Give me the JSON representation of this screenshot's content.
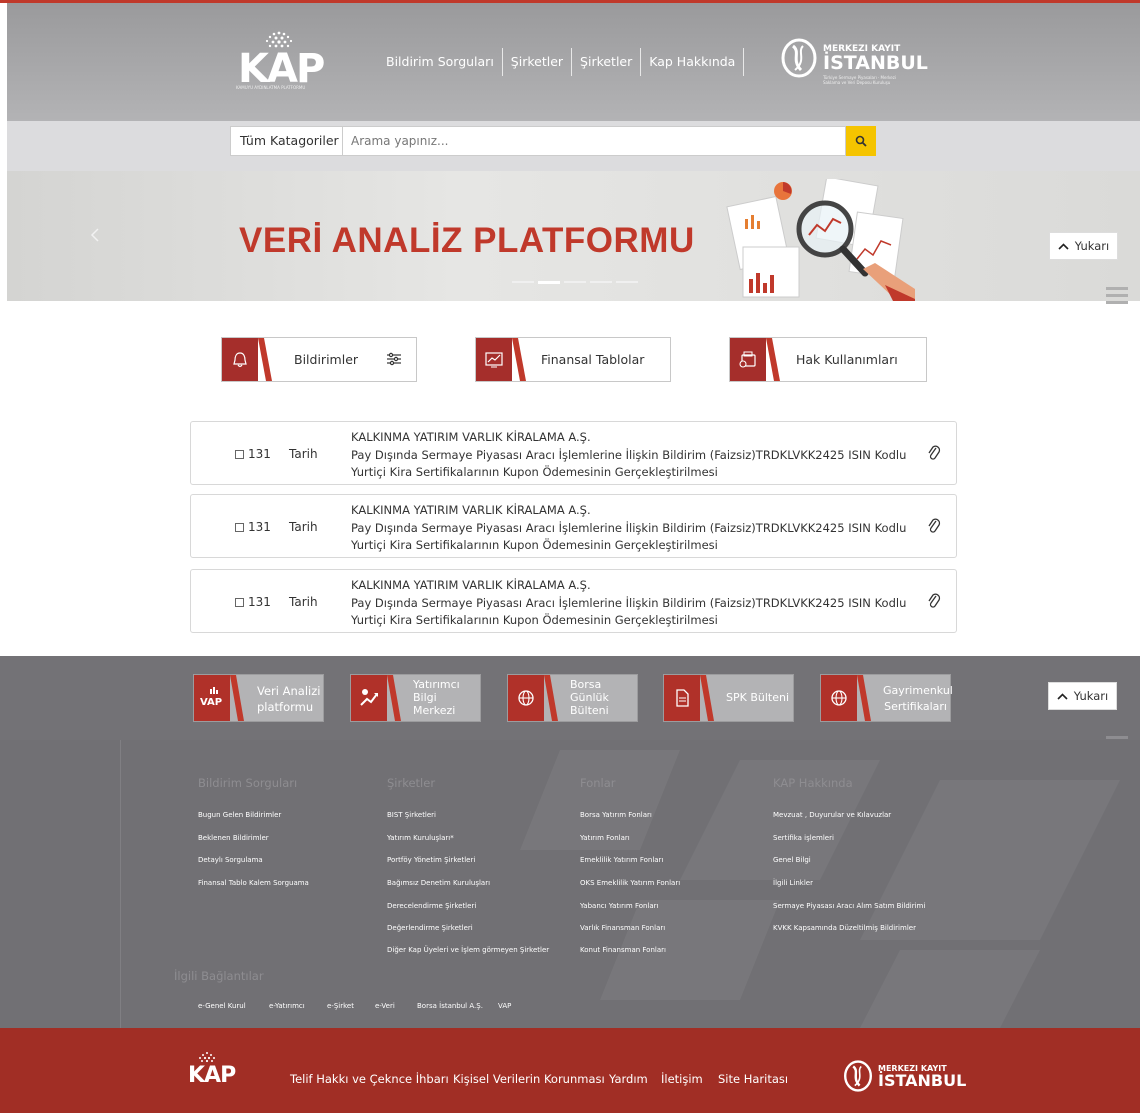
{
  "header": {
    "logo_text": "KAP",
    "logo_tagline": "KAMUYU AYDINLATMA PLATFORMU",
    "nav": [
      "Bildirim Sorguları",
      "Şirketler",
      "Şirketler",
      "Kap Hakkında"
    ],
    "mkk_line1": "MERKEZI KAYIT",
    "mkk_line2": "İSTANBUL",
    "mkk_line3": "Türkiye Sermaye Piyasaları · Merkezi Saklama ve Veri Deposu Kuruluşu"
  },
  "search": {
    "category": "Tüm Katagoriler",
    "placeholder": "Arama yapınız..."
  },
  "banner": {
    "title": "VERİ ANALİZ PLATFORMU",
    "slide_count": 5,
    "active_slide": 2
  },
  "up_button": "Yukarı",
  "quick_buttons": [
    "Bildirimler",
    "Finansal Tablolar",
    "Hak Kullanımları"
  ],
  "notifications": [
    {
      "number": "131",
      "date": "Tarih",
      "company": "KALKINMA YATIRIM VARLIK KİRALAMA A.Ş.",
      "description": "Pay Dışında Sermaye Piyasası Aracı İşlemlerine İlişkin Bildirim (Faizsiz)TRDKLVKK2425 ISIN Kodlu Yurtiçi Kira Sertifikalarının Kupon Ödemesinin Gerçekleştirilmesi"
    },
    {
      "number": "131",
      "date": "Tarih",
      "company": "KALKINMA YATIRIM VARLIK KİRALAMA A.Ş.",
      "description": "Pay Dışında Sermaye Piyasası Aracı İşlemlerine İlişkin Bildirim (Faizsiz)TRDKLVKK2425 ISIN Kodlu Yurtiçi Kira Sertifikalarının Kupon Ödemesinin Gerçekleştirilmesi"
    },
    {
      "number": "131",
      "date": "Tarih",
      "company": "KALKINMA YATIRIM VARLIK KİRALAMA A.Ş.",
      "description": "Pay Dışında Sermaye Piyasası Aracı İşlemlerine İlişkin Bildirim (Faizsiz)TRDKLVKK2425 ISIN Kodlu Yurtiçi Kira Sertifikalarının Kupon Ödemesinin Gerçekleştirilmesi"
    }
  ],
  "strip_buttons": [
    {
      "line1": "Veri Analizi",
      "line2": "platformu",
      "line3": "",
      "icon": "vap-logo-icon",
      "icon_text": "VAP"
    },
    {
      "line1": "Yatırımcı",
      "line2": "Bilgi",
      "line3": "Merkezi",
      "icon": "investor-icon",
      "icon_text": ""
    },
    {
      "line1": "Borsa",
      "line2": "Günlük",
      "line3": "Bülteni",
      "icon": "globe-icon",
      "icon_text": ""
    },
    {
      "line1": "SPK Bülteni",
      "line2": "",
      "line3": "",
      "icon": "document-icon",
      "icon_text": ""
    },
    {
      "line1": "Gayrimenkul",
      "line2": "Sertifikaları",
      "line3": "",
      "icon": "globe-icon",
      "icon_text": ""
    }
  ],
  "footer": {
    "columns": [
      {
        "title": "Bildirim Sorguları",
        "links": [
          "Bugun Gelen Bildirimler",
          "Beklenen Bildirimler",
          "Detaylı Sorgulama",
          "Finansal Tablo Kalem Sorguama"
        ]
      },
      {
        "title": "Şirketler",
        "links": [
          "BIST Şirketleri",
          "Yatırım Kuruluşları*",
          "Portföy Yönetim Şirketleri",
          "Bağımsız Denetim Kuruluşları",
          "Derecelendirme Şirketleri",
          "Değerlendirme Şirketleri",
          "Diğer Kap Üyeleri ve İşlem görmeyen Şirketler"
        ]
      },
      {
        "title": "Fonlar",
        "links": [
          "Borsa Yatırım Fonları",
          "Yatırım Fonları",
          "Emeklilik Yatırım Fonları",
          "OKS Emeklilik Yatırım Fonları",
          "Yabancı Yatırım Fonları",
          "Varlık Finansman Fonları",
          "Konut Finansman Fonları"
        ]
      },
      {
        "title": "KAP Hakkında",
        "links": [
          "Mevzuat , Duyurular ve Kılavuzlar",
          "Sertifika işlemleri",
          "Genel Bilgi",
          "İlgili Linkler",
          "Sermaye Piyasası Aracı Alım Satım Bildirimi",
          "KVKK Kapsamında Düzeltilmiş Bildirimler"
        ]
      }
    ],
    "related_title": "İlgili Bağlantılar",
    "related_links": [
      "e-Genel Kurul",
      "e-Yatırımcı",
      "e-Şirket",
      "e-Veri",
      "Borsa İstanbul A.Ş.",
      "VAP"
    ]
  },
  "bottom_bar": {
    "logo_text": "KAP",
    "links": [
      "Telif Hakkı ve Çeknce İhbarı",
      "Kişisel Verilerin Korunması",
      "Yardım",
      "İletişim",
      "Site Haritası"
    ],
    "mkk_line1": "MERKEZI KAYIT",
    "mkk_line2": "İSTANBUL"
  },
  "colors": {
    "brand_red": "#a52e2b",
    "search_yellow": "#f5c400",
    "header_gray": "#9a9a9c",
    "footer_gray": "#717074"
  }
}
